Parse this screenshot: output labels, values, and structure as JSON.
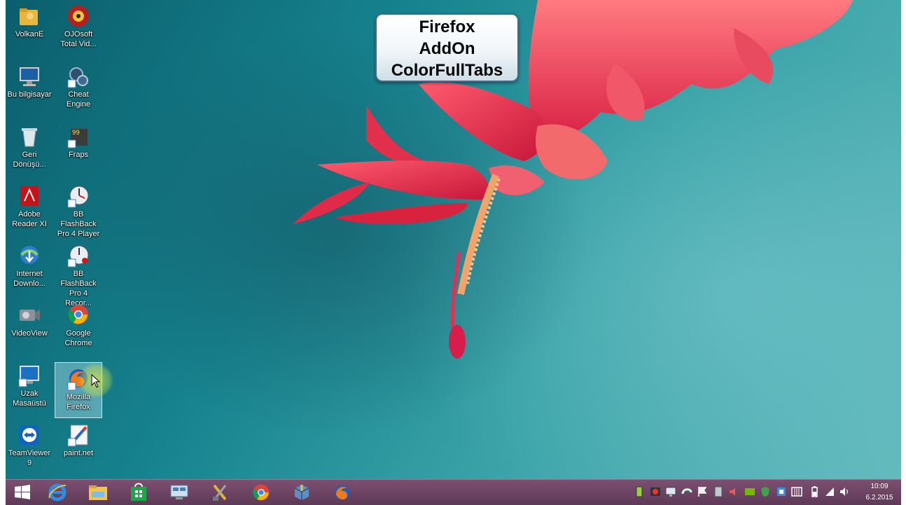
{
  "window_title": "Firefox AddOn ColorFullTabs",
  "title_card": {
    "line1": "Firefox",
    "line2": "AddOn",
    "line3": "ColorFullTabs"
  },
  "desktop_icons": [
    {
      "label": "VolkanE",
      "icon": "user-folder-icon"
    },
    {
      "label": "OJOsoft Total Vid...",
      "icon": "ojosoft-icon"
    },
    {
      "label": "Bu bilgisayar",
      "icon": "this-pc-icon"
    },
    {
      "label": "Cheat Engine",
      "icon": "cheat-engine-icon"
    },
    {
      "label": "Geri Dönüşü...",
      "icon": "recycle-bin-icon"
    },
    {
      "label": "Fraps",
      "icon": "fraps-icon"
    },
    {
      "label": "Adobe Reader XI",
      "icon": "adobe-reader-icon"
    },
    {
      "label": "BB FlashBack Pro 4 Player",
      "icon": "flashback-player-icon"
    },
    {
      "label": "Internet Downlo...",
      "icon": "internet-download-manager-icon"
    },
    {
      "label": "BB FlashBack Pro 4 Recor...",
      "icon": "flashback-recorder-icon"
    },
    {
      "label": "VideoView",
      "icon": "videoview-icon"
    },
    {
      "label": "Google Chrome",
      "icon": "chrome-icon"
    },
    {
      "label": "Uzak Masaüstü",
      "icon": "remote-desktop-icon"
    },
    {
      "label": "Mozilla Firefox",
      "icon": "firefox-icon"
    },
    {
      "label": "TeamViewer 9",
      "icon": "teamviewer-icon"
    },
    {
      "label": "paint.net",
      "icon": "paint-net-icon"
    }
  ],
  "taskbar": {
    "pinned": [
      "start-icon",
      "internet-explorer-icon",
      "file-explorer-icon",
      "store-icon",
      "network-app-icon",
      "tools-app-icon",
      "chrome-icon",
      "package-icon",
      "firefox-icon"
    ],
    "clock": {
      "time": "10:09",
      "date": "6.2.2015"
    }
  },
  "colors": {
    "taskbar": "#6a445f",
    "accent_flower": "#e2334f",
    "desktop_bg": "#2a8f99"
  }
}
